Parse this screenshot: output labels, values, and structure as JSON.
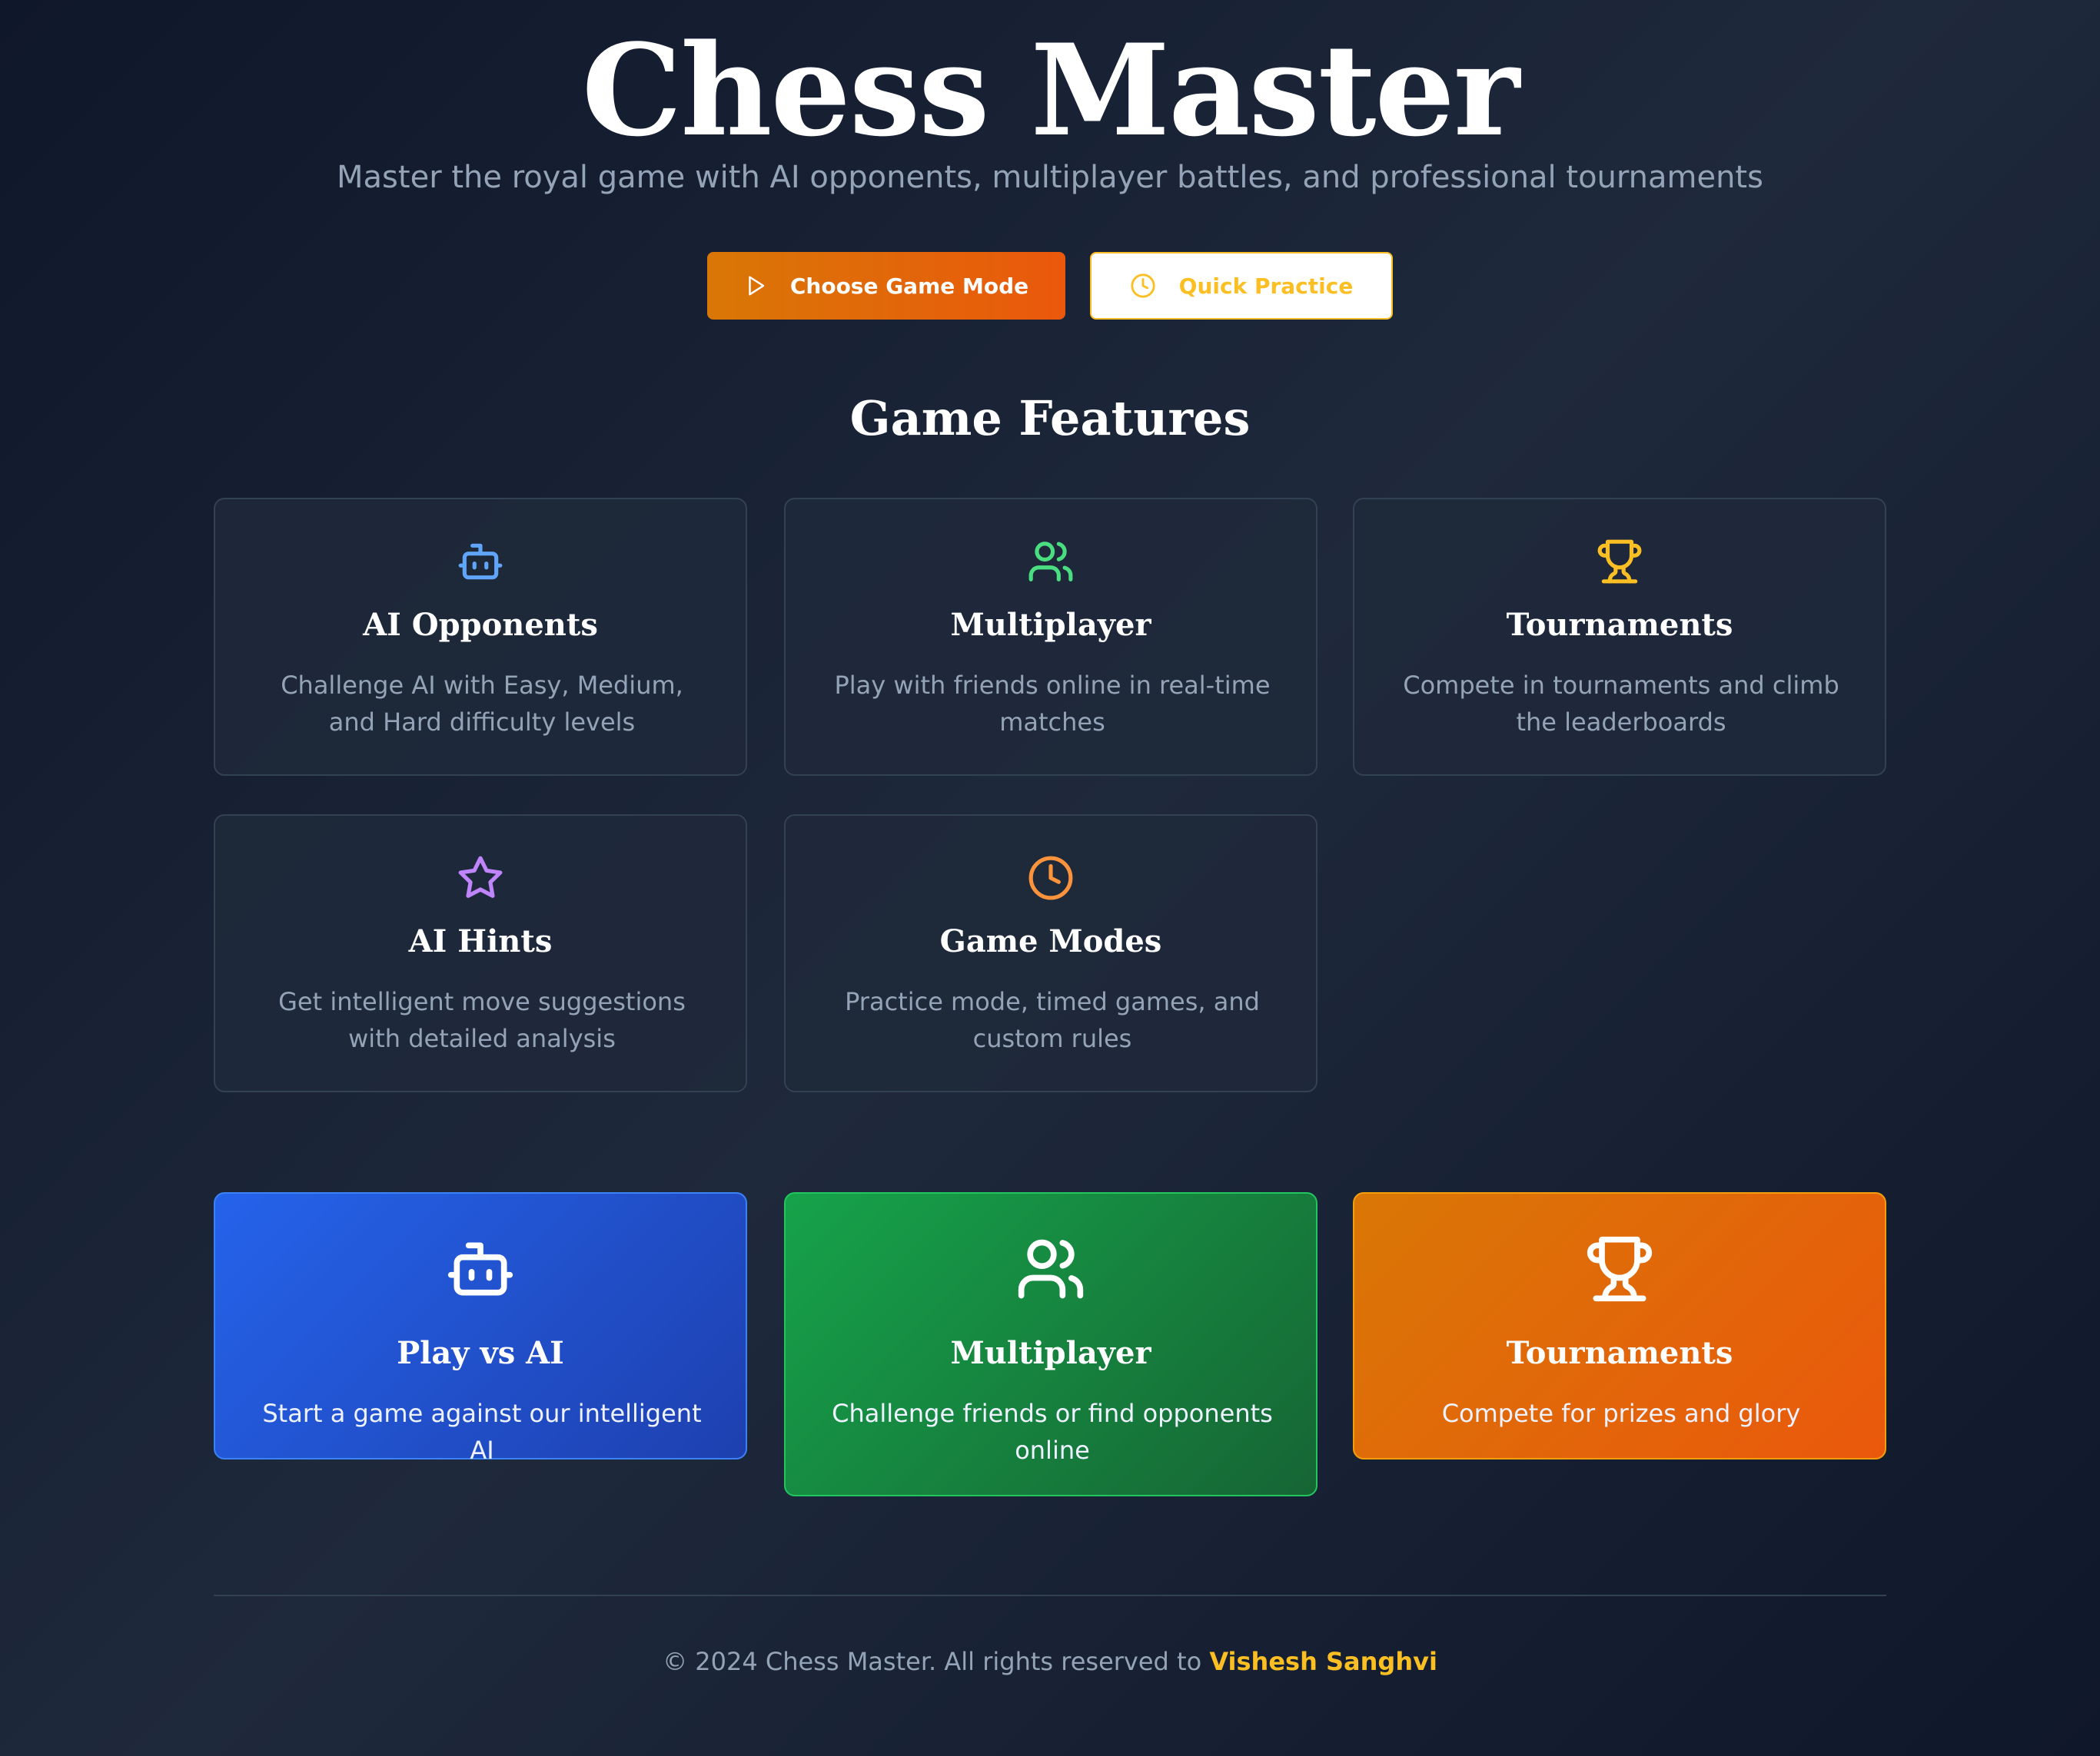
{
  "hero": {
    "title": "Chess Master",
    "subtitle": "Master the royal game with AI opponents, multiplayer battles, and professional tournaments"
  },
  "actions": {
    "primary_label": "Choose Game Mode",
    "primary_icon": "play-icon",
    "secondary_label": "Quick Practice",
    "secondary_icon": "clock-icon"
  },
  "features": {
    "heading": "Game Features",
    "items": [
      {
        "title": "AI Opponents",
        "description": "Challenge AI with Easy, Medium, and Hard difficulty levels",
        "icon": "bot-icon",
        "color": "#60a5fa"
      },
      {
        "title": "Multiplayer",
        "description": "Play with friends online in real-time matches",
        "icon": "users-icon",
        "color": "#4ade80"
      },
      {
        "title": "Tournaments",
        "description": "Compete in tournaments and climb the leaderboards",
        "icon": "trophy-icon",
        "color": "#fbbf24"
      },
      {
        "title": "AI Hints",
        "description": "Get intelligent move suggestions with detailed analysis",
        "icon": "star-icon",
        "color": "#c084fc"
      },
      {
        "title": "Game Modes",
        "description": "Practice mode, timed games, and custom rules",
        "icon": "clock-icon",
        "color": "#fb923c"
      }
    ]
  },
  "modes": [
    {
      "title": "Play vs AI",
      "description": "Start a game against our intelligent AI",
      "icon": "bot-icon",
      "color": "#2563eb"
    },
    {
      "title": "Multiplayer",
      "description": "Challenge friends or find opponents online",
      "icon": "users-icon",
      "color": "#16a34a"
    },
    {
      "title": "Tournaments",
      "description": "Compete for prizes and glory",
      "icon": "trophy-icon",
      "color": "#ea580c"
    }
  ],
  "footer": {
    "text": "© 2024 Chess Master. All rights reserved to",
    "author": "Vishesh Sanghvi"
  },
  "theme": {
    "accent": "#fbbf24",
    "primary_gradient_start": "#d97706",
    "primary_gradient_end": "#ea580c",
    "background": "#0f172a"
  }
}
